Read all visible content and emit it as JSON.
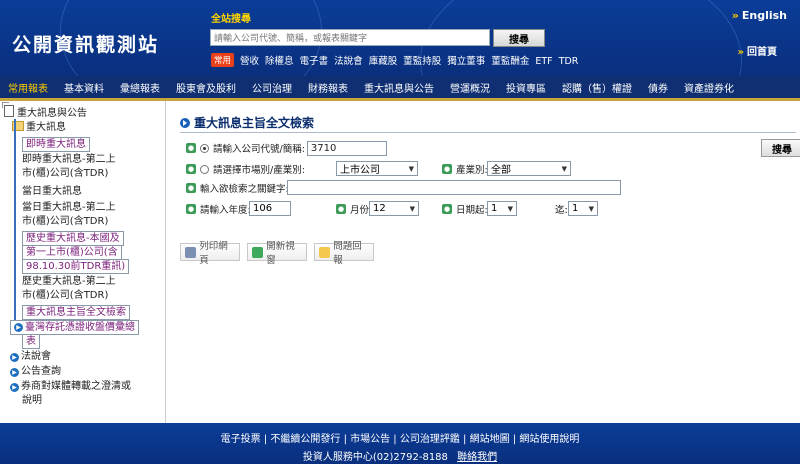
{
  "header": {
    "logo": "公開資訊觀測站",
    "search_label": "全站搜尋",
    "search_placeholder": "請輸入公司代號、簡稱，或報表關鍵字",
    "search_button": "搜尋",
    "common_tag": "常用",
    "quick_links": [
      "營收",
      "除權息",
      "電子書",
      "法說會",
      "庫藏股",
      "董監持股",
      "獨立董事",
      "董監酬金",
      "ETF",
      "TDR"
    ],
    "english": "English",
    "home": "回首頁"
  },
  "nav": {
    "items": [
      "常用報表",
      "基本資料",
      "彙總報表",
      "股東會及股利",
      "公司治理",
      "財務報表",
      "重大訊息與公告",
      "營運概況",
      "投資專區",
      "認購（售）權證",
      "債券",
      "資產證券化"
    ],
    "active_index": 0
  },
  "sidebar": {
    "root": "重大訊息與公告",
    "folder": "重大訊息",
    "items": [
      {
        "label": "即時重大訊息",
        "selected": true
      },
      {
        "label": "即時重大訊息-第二上",
        "selected": false
      },
      {
        "label": "市(櫃)公司(含TDR)",
        "selected": false
      },
      {
        "label": "當日重大訊息",
        "selected": false
      },
      {
        "label": "當日重大訊息-第二上",
        "selected": false
      },
      {
        "label": "市(櫃)公司(含TDR)",
        "selected": false
      },
      {
        "label": "歷史重大訊息-本國及",
        "selected": true
      },
      {
        "label": "第一上市(櫃)公司(含",
        "selected": true
      },
      {
        "label": "98.10.30前TDR重訊)",
        "selected": true
      },
      {
        "label": "歷史重大訊息-第二上",
        "selected": false
      },
      {
        "label": "市(櫃)公司(含TDR)",
        "selected": false
      },
      {
        "label": "重大訊息主旨全文檢索",
        "selected": true
      }
    ],
    "groups": [
      {
        "lines": [
          "臺灣存託憑證收盤價彙總",
          "表"
        ],
        "highlight": true
      },
      {
        "lines": [
          "法說會"
        ],
        "highlight": false
      },
      {
        "lines": [
          "公告查詢"
        ],
        "highlight": false
      },
      {
        "lines": [
          "券商對媒體轉載之澄清或",
          "說明"
        ],
        "highlight": false
      }
    ]
  },
  "main": {
    "title": "重大訊息主旨全文檢索",
    "company_label": "請輸入公司代號/簡稱:",
    "company_value": "3710",
    "market_label": "請選擇市場別/產業別:",
    "market_value": "上市公司",
    "industry_label": "產業別:",
    "industry_value": "全部",
    "keyword_label": "輸入欲檢索之關鍵字:",
    "keyword_value": "",
    "year_label": "請輸入年度:",
    "year_value": "106",
    "month_label": "月份:",
    "month_value": "12",
    "date_from_label": "日期起:",
    "date_from_value": "1",
    "date_to_label": "迄:",
    "date_to_value": "1",
    "submit": "搜尋",
    "tools": [
      "列印網頁",
      "開新視窗",
      "問題回報"
    ]
  },
  "footer": {
    "links": [
      "電子投票",
      "不繼續公開發行",
      "市場公告",
      "公司治理評鑑",
      "網站地圖",
      "網站使用說明"
    ],
    "contact": "投資人服務中心(02)2792-8188",
    "contact_link": "聯絡我們"
  }
}
